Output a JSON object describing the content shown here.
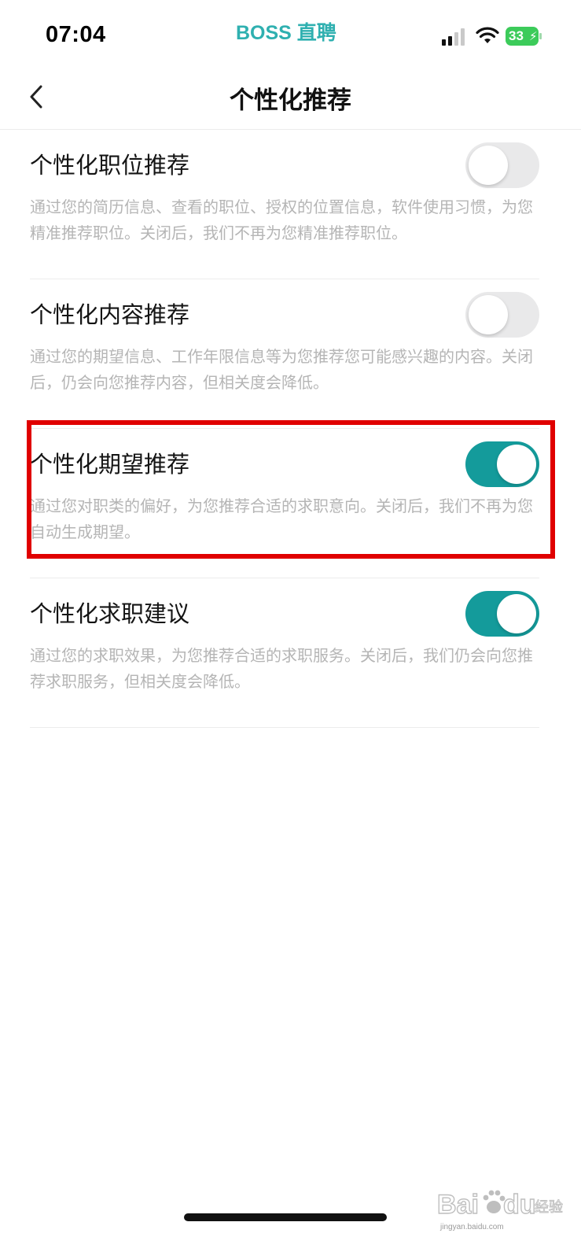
{
  "status_bar": {
    "time": "07:04",
    "brand": "BOSS 直聘",
    "battery": "33",
    "signal_icon": "cellular-signal-icon",
    "wifi_icon": "wifi-icon",
    "battery_icon": "battery-charging-icon"
  },
  "nav": {
    "title": "个性化推荐",
    "back_icon": "chevron-left-icon"
  },
  "settings": [
    {
      "title": "个性化职位推荐",
      "description": "通过您的简历信息、查看的职位、授权的位置信息，软件使用习惯，为您精准推荐职位。关闭后，我们不再为您精准推荐职位。",
      "enabled": false
    },
    {
      "title": "个性化内容推荐",
      "description": "通过您的期望信息、工作年限信息等为您推荐您可能感兴趣的内容。关闭后，仍会向您推荐内容，但相关度会降低。",
      "enabled": false
    },
    {
      "title": "个性化期望推荐",
      "description": "通过您对职类的偏好，为您推荐合适的求职意向。关闭后，我们不再为您自动生成期望。",
      "enabled": true
    },
    {
      "title": "个性化求职建议",
      "description": "通过您的求职效果，为您推荐合适的求职服务。关闭后，我们仍会向您推荐求职服务，但相关度会降低。",
      "enabled": true
    }
  ],
  "colors": {
    "accent": "#149b9b",
    "brand": "#2fb0b0",
    "highlight": "#e00000",
    "toggle_off": "#e9e9ea",
    "description_text": "#b5b5b5"
  },
  "watermark": {
    "logo": "Bai du 经验",
    "url": "jingyan.baidu.com"
  }
}
